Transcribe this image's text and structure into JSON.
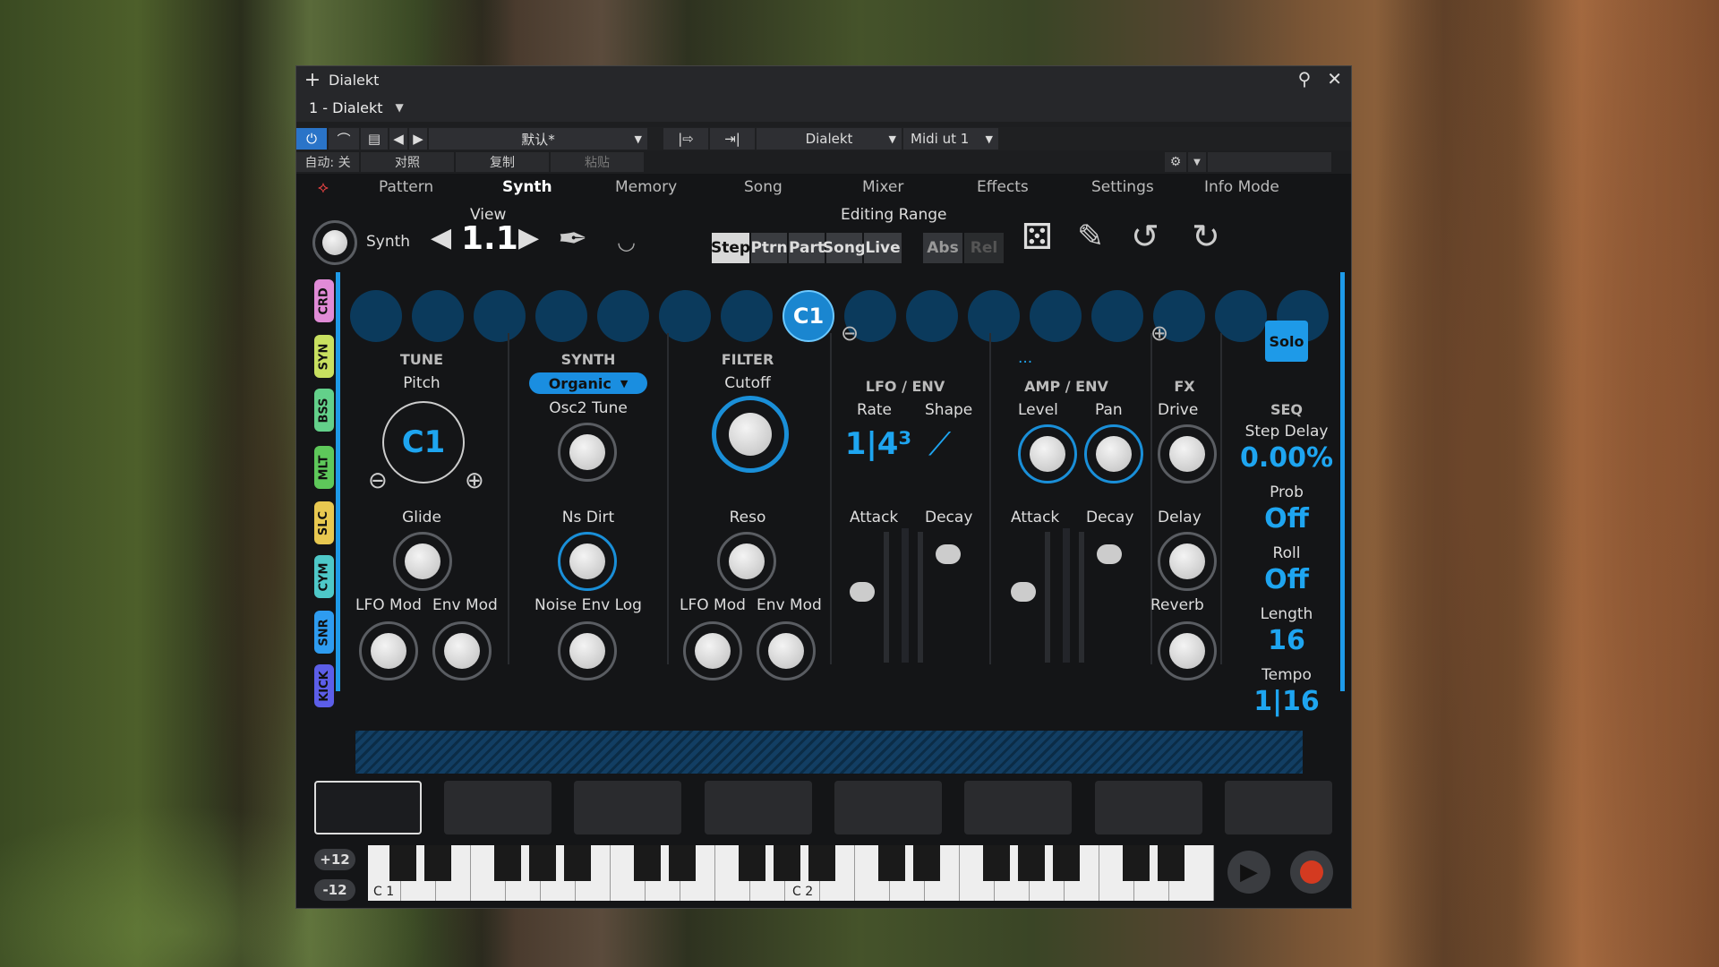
{
  "window": {
    "title": "Dialekt",
    "subtitle": "1 - Dialekt"
  },
  "toolbar": {
    "preset": "默认*",
    "device": "Dialekt",
    "midi": "Midi ut 1"
  },
  "row4": {
    "auto": "自动: 关",
    "compare": "对照",
    "copy": "复制",
    "paste": "粘贴"
  },
  "nav": {
    "items": [
      "Pattern",
      "Synth",
      "Memory",
      "Song",
      "Mixer",
      "Effects",
      "Settings",
      "Info Mode"
    ],
    "active": "Synth"
  },
  "header": {
    "synth": "Synth",
    "view_label": "View",
    "view_value": "1.1",
    "editing_range": "Editing Range",
    "range_buttons": [
      "Step",
      "Ptrn",
      "Part",
      "Song",
      "Live"
    ],
    "abs": "Abs",
    "rel": "Rel"
  },
  "steps": {
    "active_label": "C1"
  },
  "side_tabs": [
    "CRD",
    "SYN",
    "BSS",
    "MLT",
    "SLC",
    "CYM",
    "SNR",
    "KICK"
  ],
  "tune": {
    "title": "TUNE",
    "pitch": "Pitch",
    "pitch_value": "C1",
    "glide": "Glide",
    "lfo_mod": "LFO Mod",
    "env_mod": "Env Mod"
  },
  "synth": {
    "title": "SYNTH",
    "mode": "Organic",
    "osc2": "Osc2 Tune",
    "ns_dirt": "Ns Dirt",
    "noise_env": "Noise Env Log"
  },
  "filter": {
    "title": "FILTER",
    "cutoff": "Cutoff",
    "reso": "Reso",
    "lfo_mod": "LFO Mod",
    "env_mod": "Env Mod"
  },
  "lfo": {
    "title": "LFO / ENV",
    "rate": "Rate",
    "shape": "Shape",
    "rate_value": "1|4³",
    "attack": "Attack",
    "decay": "Decay"
  },
  "amp": {
    "title": "AMP / ENV",
    "dots": "...",
    "level": "Level",
    "pan": "Pan",
    "attack": "Attack",
    "decay": "Decay"
  },
  "fx": {
    "title": "FX",
    "drive": "Drive",
    "delay": "Delay",
    "reverb": "Reverb"
  },
  "seq": {
    "solo": "Solo",
    "title": "SEQ",
    "step_delay": "Step Delay",
    "step_delay_value": "0.00%",
    "prob": "Prob",
    "prob_value": "Off",
    "roll": "Roll",
    "roll_value": "Off",
    "length": "Length",
    "length_value": "16",
    "tempo": "Tempo",
    "tempo_value": "1|16"
  },
  "keyboard": {
    "oct_up": "+12",
    "oct_down": "-12",
    "c1": "C 1",
    "c2": "C 2"
  }
}
